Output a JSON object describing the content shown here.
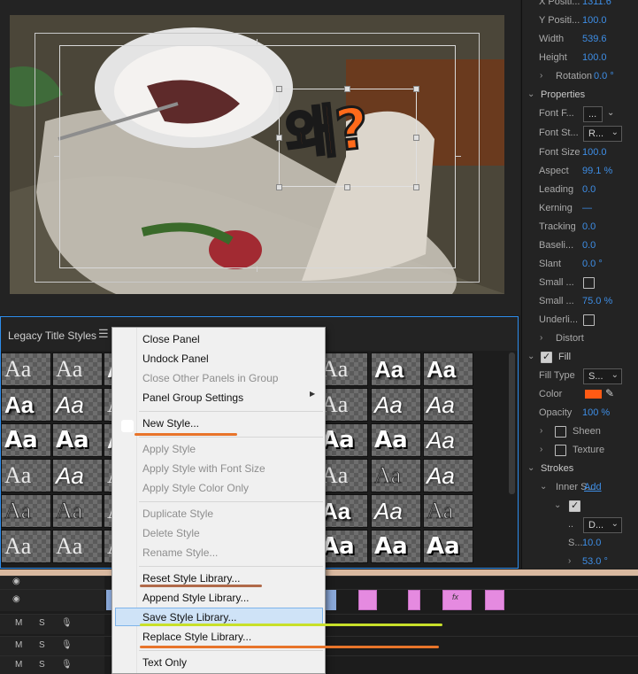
{
  "properties": {
    "rows": [
      {
        "label": "X Positi...",
        "value": "1311.6"
      },
      {
        "label": "Y Positi...",
        "value": "100.0"
      },
      {
        "label": "Width",
        "value": "539.6"
      },
      {
        "label": "Height",
        "value": "100.0"
      },
      {
        "label": "Rotation",
        "value": "0.0 °"
      }
    ],
    "section_properties": "Properties",
    "font_family": {
      "label": "Font F...",
      "value": "..."
    },
    "font_style": {
      "label": "Font St...",
      "value": "R..."
    },
    "font_size": {
      "label": "Font Size",
      "value": "100.0"
    },
    "aspect": {
      "label": "Aspect",
      "value": "99.1 %"
    },
    "leading": {
      "label": "Leading",
      "value": "0.0"
    },
    "kerning": {
      "label": "Kerning",
      "value": "—"
    },
    "tracking": {
      "label": "Tracking",
      "value": "0.0"
    },
    "baseline": {
      "label": "Baseli...",
      "value": "0.0"
    },
    "slant": {
      "label": "Slant",
      "value": "0.0 °"
    },
    "small_caps": {
      "label": "Small ..."
    },
    "small_caps_size": {
      "label": "Small ...",
      "value": "75.0 %"
    },
    "underline": {
      "label": "Underli..."
    },
    "distort": "Distort",
    "fill": "Fill",
    "fill_type": {
      "label": "Fill Type",
      "value": "S..."
    },
    "color": {
      "label": "Color",
      "swatch": "#ff5a14"
    },
    "opacity": {
      "label": "Opacity",
      "value": "100 %"
    },
    "sheen": "Sheen",
    "texture": "Texture",
    "strokes": "Strokes",
    "inner_strokes": {
      "label": "Inner S...",
      "add": "Add"
    },
    "stroke_type": {
      "value": "D..."
    },
    "stroke_size": {
      "label": "S...",
      "value": "10.0"
    },
    "stroke_angle": {
      "value": "53.0 °"
    }
  },
  "monitor": {
    "title_text": "왜?",
    "title_color": "#ff6a1a"
  },
  "styles_panel": {
    "title": "Legacy Title Styles",
    "menu_icon": "hamburger-icon",
    "swatch_text": "Aa"
  },
  "context_menu": {
    "items": [
      {
        "label": "Close Panel",
        "enabled": true
      },
      {
        "label": "Undock Panel",
        "enabled": true
      },
      {
        "label": "Close Other Panels in Group",
        "enabled": false
      },
      {
        "label": "Panel Group Settings",
        "enabled": true,
        "submenu": true
      },
      {
        "label": "New Style...",
        "enabled": true
      },
      {
        "label": "Apply Style",
        "enabled": false
      },
      {
        "label": "Apply Style with Font Size",
        "enabled": false
      },
      {
        "label": "Apply Style Color Only",
        "enabled": false
      },
      {
        "label": "Duplicate Style",
        "enabled": false
      },
      {
        "label": "Delete Style",
        "enabled": false
      },
      {
        "label": "Rename Style...",
        "enabled": false
      },
      {
        "label": "Reset Style Library...",
        "enabled": true
      },
      {
        "label": "Append Style Library...",
        "enabled": true
      },
      {
        "label": "Save Style Library...",
        "enabled": true,
        "highlighted": true
      },
      {
        "label": "Replace Style Library...",
        "enabled": true
      },
      {
        "label": "Text Only",
        "enabled": true
      }
    ],
    "submenu_arrow": "▶"
  },
  "timeline": {
    "track_buttons": {
      "mute": "M",
      "solo": "S"
    },
    "fx_badge": "fx"
  },
  "colors": {
    "accent_blue": "#2d8ceb",
    "value_blue": "#3e8ee6",
    "annotation_orange": "#e8742a",
    "annotation_green": "#c8e02a",
    "annotation_brown": "#b06a4a"
  }
}
